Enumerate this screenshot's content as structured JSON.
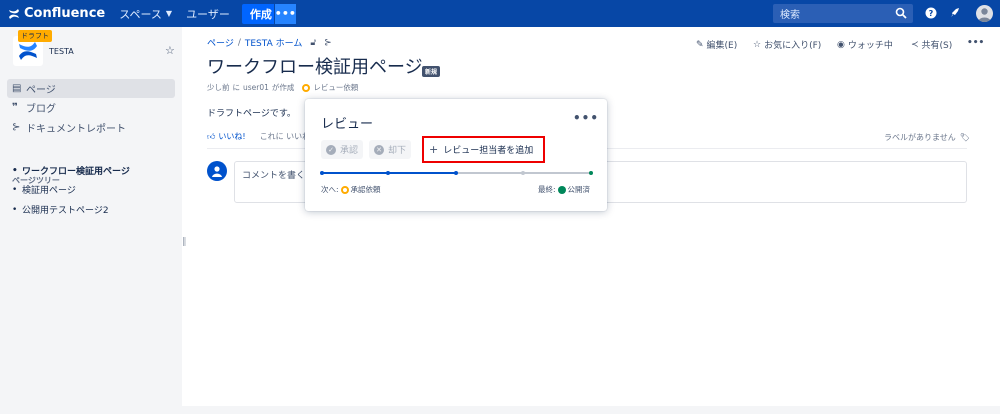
{
  "topbar": {
    "product": "Confluence",
    "spaces": "スペース",
    "users": "ユーザー",
    "create": "作成",
    "create_more": "•••",
    "search_placeholder": "検索"
  },
  "sidebar": {
    "draft_tag": "ドラフト",
    "space_name": "TESTA",
    "items": [
      {
        "label": "ページ",
        "icon": "page-icon"
      },
      {
        "label": "ブログ",
        "icon": "quote-icon"
      },
      {
        "label": "ドキュメントレポート",
        "icon": "tree-icon"
      }
    ],
    "tree_heading": "ページツリー",
    "tree": [
      {
        "label": "ワークフロー検証用ページ",
        "current": true
      },
      {
        "label": "検証用ページ",
        "current": false
      },
      {
        "label": "公開用テストページ2",
        "current": false
      }
    ]
  },
  "breadcrumb": {
    "page": "ページ",
    "sep": "/",
    "home": "TESTA ホーム"
  },
  "actions": {
    "edit": "編集(E)",
    "favorite": "お気に入り(F)",
    "watch": "ウォッチ中",
    "share": "共有(S)",
    "more": "•••"
  },
  "page": {
    "title": "ワークフロー検証用ページ",
    "badge": "新規",
    "meta_time": "少し前",
    "meta_in": "に",
    "meta_user": "user01",
    "meta_created": "が作成",
    "meta_status": "レビュー依頼",
    "body": "ドラフトページです。",
    "like": "いいね!",
    "like_first": "これに いいね",
    "no_labels": "ラベルがありません",
    "comment_placeholder": "コメントを書く..."
  },
  "popup": {
    "title": "レビュー",
    "more": "•••",
    "approve": "承認",
    "reject": "却下",
    "add_reviewer": "レビュー担当者を追加",
    "next_label": "次へ:",
    "next_status": "承認依頼",
    "final_label": "最終:",
    "final_status": "公開済"
  },
  "colors": {
    "topbar": "#0747a6",
    "create": "#0065ff",
    "progress_done": "#0052cc",
    "progress_todo": "#c1c7d0",
    "final": "#00875a",
    "pending": "#ffab00",
    "highlight": "#e00000"
  },
  "workflow_progress": {
    "steps": 5,
    "completed": 3
  }
}
